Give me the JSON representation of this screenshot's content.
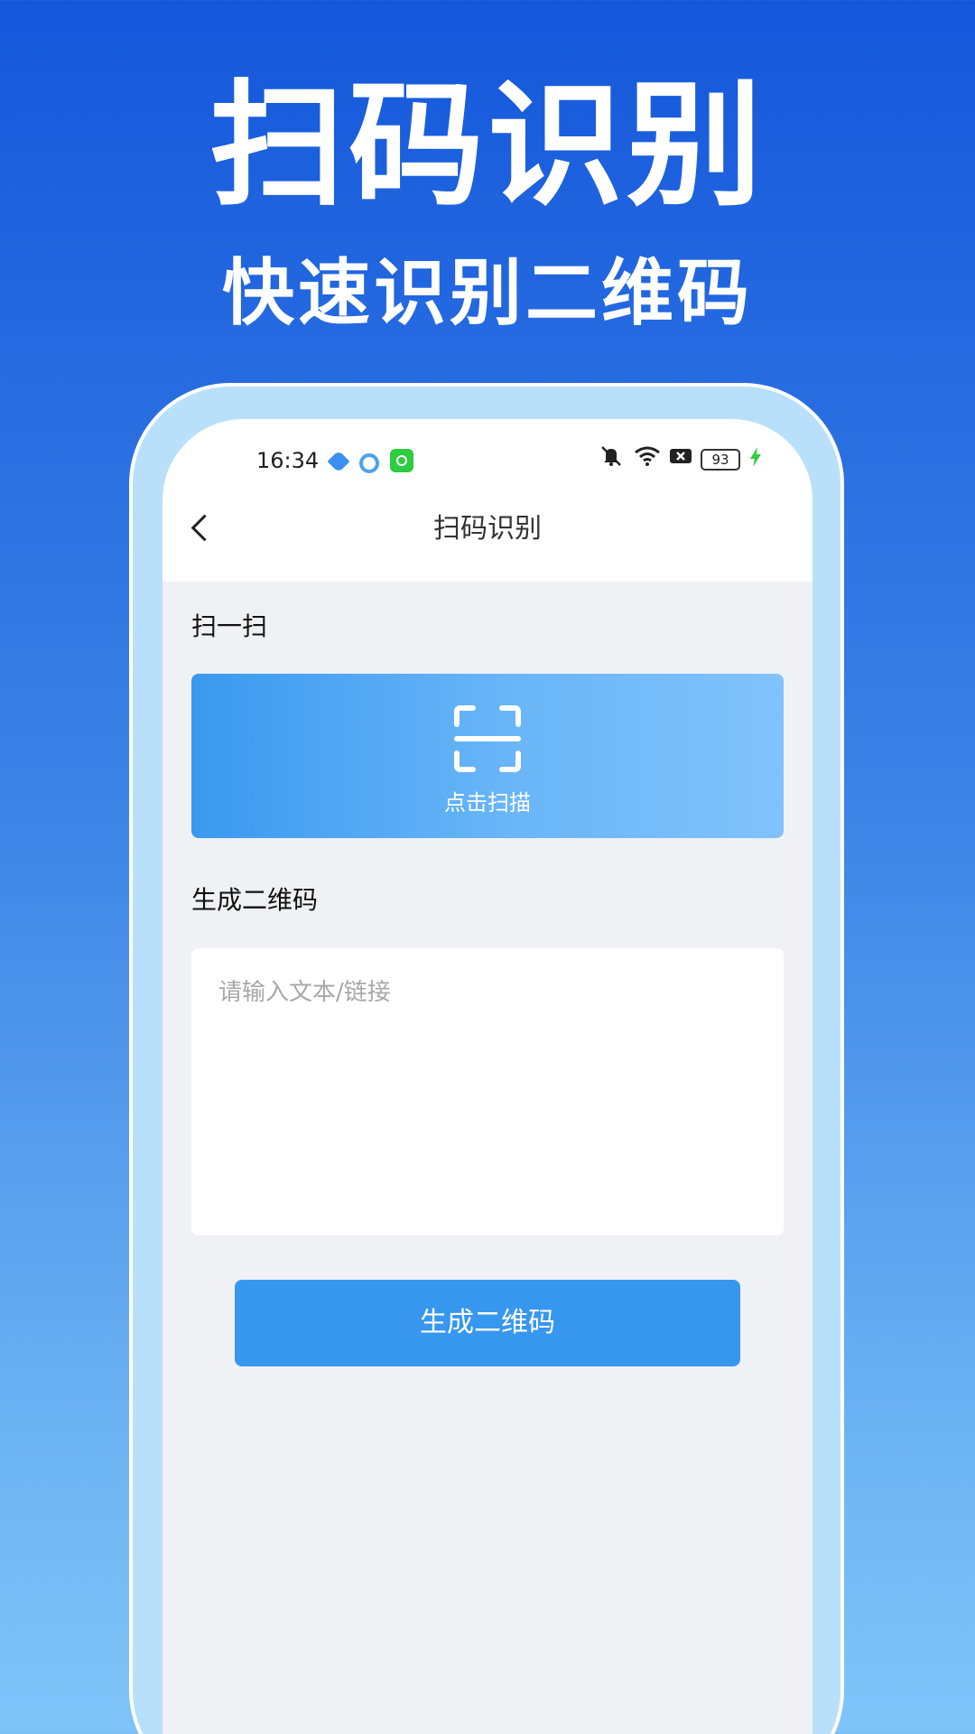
{
  "promo": {
    "title": "扫码识别",
    "subtitle": "快速识别二维码"
  },
  "status_bar": {
    "time": "16:34",
    "battery": "93",
    "icons": [
      "app-icon-1",
      "app-icon-2",
      "app-icon-3",
      "mute-icon",
      "wifi-icon",
      "signal-off-icon",
      "battery-icon",
      "charging-icon"
    ]
  },
  "nav": {
    "title": "扫码识别",
    "back_icon": "chevron-left-icon"
  },
  "scan_section": {
    "label": "扫一扫",
    "button_caption": "点击扫描",
    "icon": "scan-frame-icon"
  },
  "generate_section": {
    "label": "生成二维码",
    "input_placeholder": "请输入文本/链接",
    "input_value": "",
    "button_label": "生成二维码"
  },
  "colors": {
    "accent": "#3797ef",
    "scan_gradient_start": "#3a99f0",
    "scan_gradient_end": "#80c2fb",
    "screen_bg": "#eff1f5"
  }
}
